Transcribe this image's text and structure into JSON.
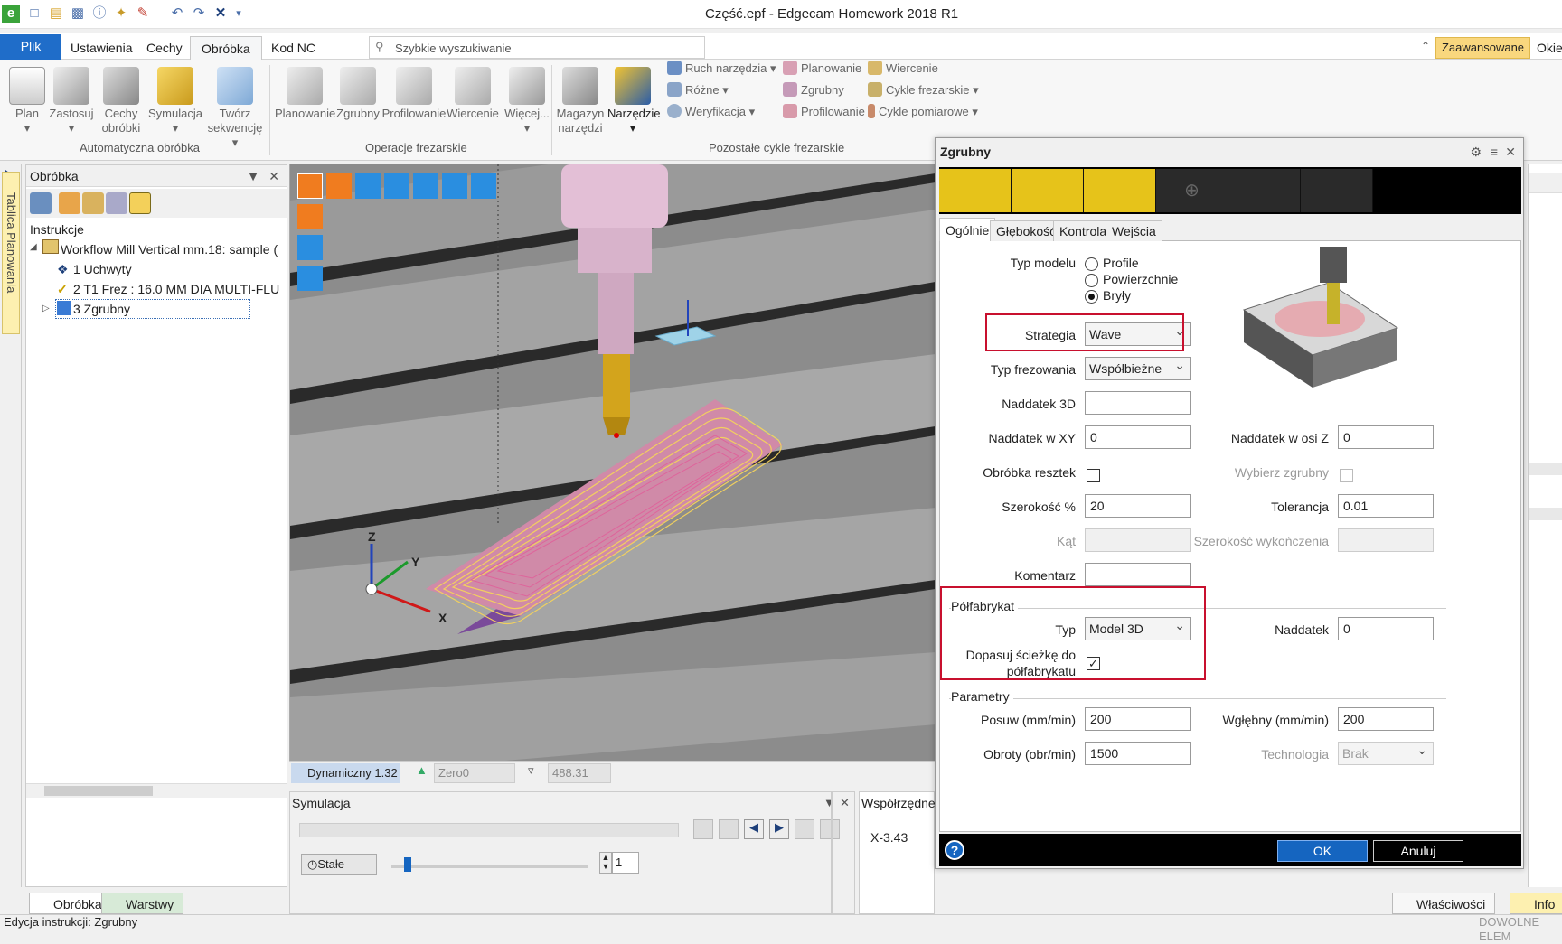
{
  "app": {
    "title": "Część.epf - Edgecam Homework 2018 R1"
  },
  "menu": {
    "tabs": [
      "Plik",
      "Ustawienia",
      "Cechy",
      "Obróbka",
      "Kod NC"
    ],
    "active_tab": "Obróbka",
    "search_placeholder": "Szybkie wyszukiwanie",
    "advanced_label": "Zaawansowane",
    "window_label": "Okie"
  },
  "ribbon": {
    "big_buttons": [
      "Plan",
      "Zastosuj",
      "Cechy obróbki",
      "Symulacja",
      "Twórz sekwencję",
      "Planowanie",
      "Zgrubny",
      "Profilowanie",
      "Wiercenie",
      "Więcej...",
      "Magazyn narzędzi",
      "Narzędzie"
    ],
    "small_buttons": [
      "Ruch narzędzia",
      "Różne",
      "Weryfikacja",
      "Planowanie",
      "Zgrubny",
      "Profilowanie",
      "Wiercenie",
      "Cykle frezarskie",
      "Cykle pomiarowe"
    ],
    "groups": [
      "Automatyczna obróbka",
      "Operacje frezarskie",
      "Pozostałe cykle frezarskie"
    ]
  },
  "left_panel": {
    "side_tab": "Tablica Planowania",
    "title": "Obróbka",
    "tree_header": "Instrukcje",
    "items": [
      "Workflow Mill Vertical mm.18: sample (",
      "1 Uchwyty",
      "2 T1 Frez : 16.0 MM DIA MULTI-FLU",
      "3 Zgrubny"
    ],
    "bottom_tabs": [
      "Obróbka",
      "Warstwy"
    ]
  },
  "viewport": {
    "axis_x": "X",
    "axis_y": "Y",
    "axis_z": "Z",
    "view_mode": "Dynamiczny 1.32",
    "cpl": "Zero0",
    "depth": "488.31"
  },
  "simulation": {
    "title": "Symulacja",
    "speed_label": "Stałe",
    "step_value": "1"
  },
  "coords": {
    "title": "Współrzędne",
    "x": "X-3.43"
  },
  "dialog": {
    "title": "Zgrubny",
    "tabs": [
      "Ogólnie",
      "Głębokość",
      "Kontrola",
      "Wejścia"
    ],
    "model_type_label": "Typ modelu",
    "model_types": [
      "Profile",
      "Powierzchnie",
      "Bryły"
    ],
    "model_type_selected": "Bryły",
    "strategy_label": "Strategia",
    "strategy_value": "Wave",
    "milling_type_label": "Typ frezowania",
    "milling_type_value": "Współbieżne",
    "allowance3d_label": "Naddatek 3D",
    "allowance3d_value": "",
    "allowance_xy_label": "Naddatek w XY",
    "allowance_xy_value": "0",
    "allowance_z_label": "Naddatek w osi Z",
    "allowance_z_value": "0",
    "rest_label": "Obróbka resztek",
    "rest_checked": false,
    "select_rough_label": "Wybierz zgrubny",
    "width_label": "Szerokość %",
    "width_value": "20",
    "tolerance_label": "Tolerancja",
    "tolerance_value": "0.01",
    "angle_label": "Kąt",
    "finish_width_label": "Szerokość wykończenia",
    "comment_label": "Komentarz",
    "comment_value": "",
    "stock_section": "Półfabrykat",
    "stock_type_label": "Typ",
    "stock_type_value": "Model 3D",
    "stock_allowance_label": "Naddatek",
    "stock_allowance_value": "0",
    "fit_path_label_1": "Dopasuj ścieżkę do",
    "fit_path_label_2": "półfabrykatu",
    "fit_path_checked": true,
    "params_section": "Parametry",
    "feed_label": "Posuw (mm/min)",
    "feed_value": "200",
    "plunge_label": "Wgłębny (mm/min)",
    "plunge_value": "200",
    "speed_label": "Obroty (obr/min)",
    "speed_value": "1500",
    "tech_label": "Technologia",
    "tech_value": "Brak",
    "ok_label": "OK",
    "cancel_label": "Anuluj"
  },
  "right_panel": {
    "tabs": [
      "Właściwości",
      "Info"
    ]
  },
  "status": {
    "text": "Edycja instrukcji:  Zgrubny",
    "right": "DOWOLNE ELEM"
  },
  "colors": {
    "accent_blue": "#1f6dc9",
    "highlight_yellow": "#e6c31a",
    "callout_red": "#c8102e",
    "toolpath_yellow": "#f5d35c",
    "toolpath_pink": "#e0609a"
  }
}
